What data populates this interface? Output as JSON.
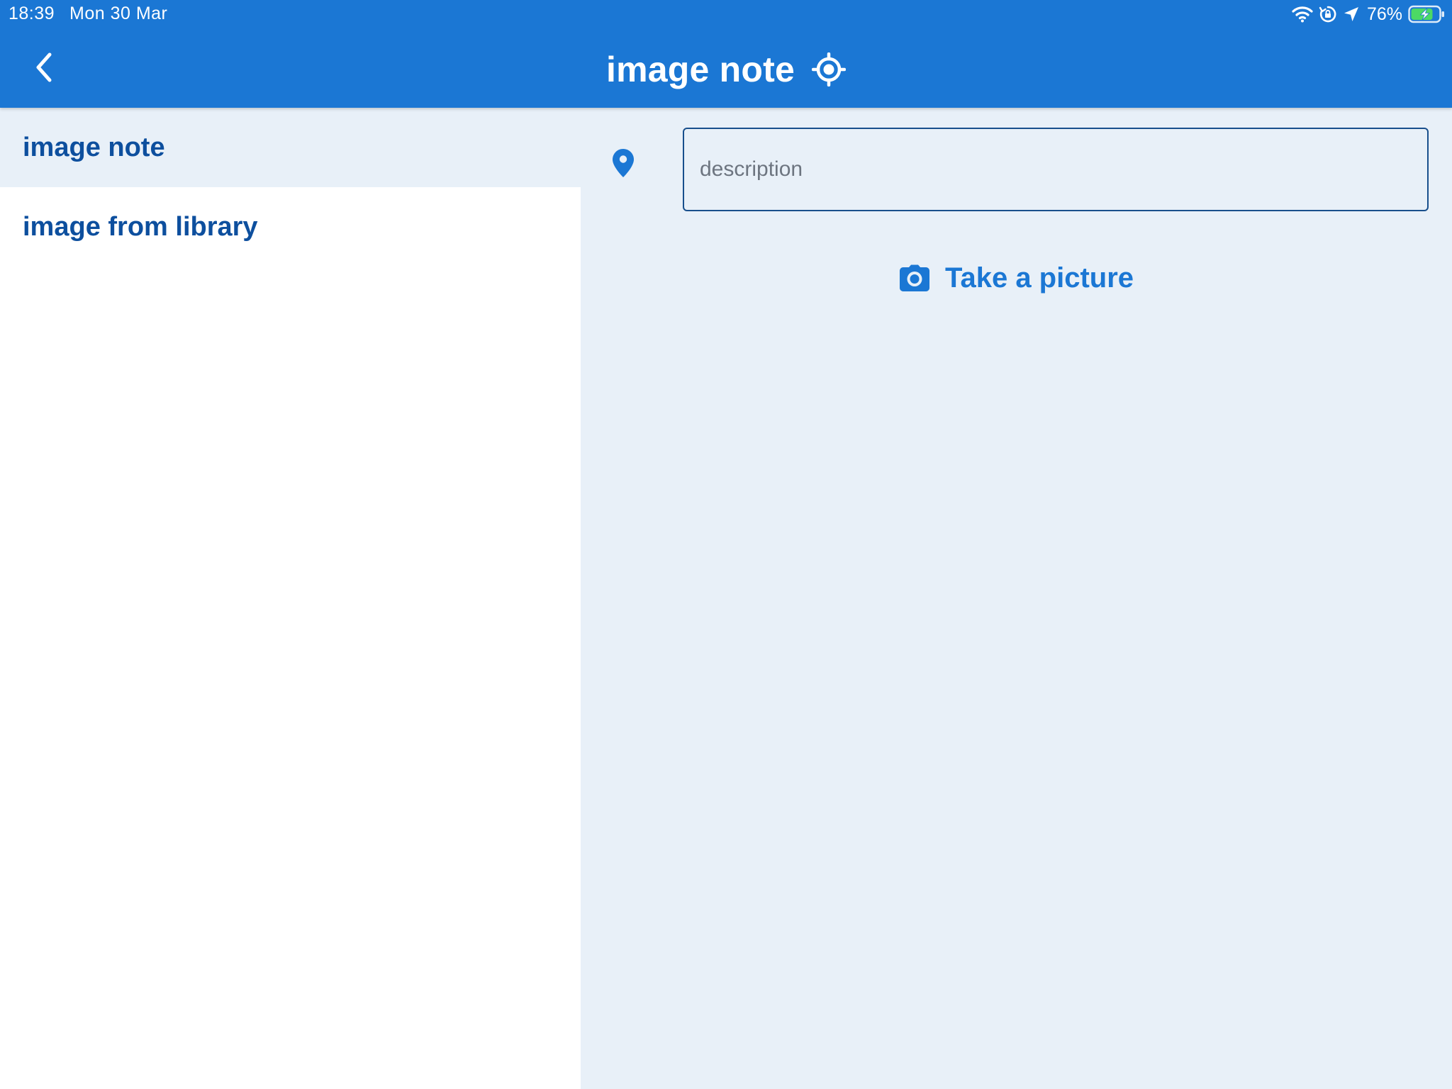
{
  "status_bar": {
    "time": "18:39",
    "date": "Mon 30 Mar",
    "battery_percent": "76%",
    "icons": [
      "wifi-icon",
      "rotation-lock-icon",
      "location-arrow-icon",
      "battery-charging-icon"
    ]
  },
  "nav_bar": {
    "title": "image note",
    "back_icon": "chevron-left-icon",
    "action_icon": "crosshair-locate-icon"
  },
  "sidebar": {
    "items": [
      {
        "label": "image note",
        "selected": true
      },
      {
        "label": "image from library",
        "selected": false
      }
    ]
  },
  "detail": {
    "location_icon": "map-pin-icon",
    "description": {
      "value": "",
      "placeholder": "description"
    },
    "take_picture": {
      "label": "Take a picture",
      "icon": "camera-icon"
    }
  },
  "colors": {
    "primary": "#1b77d4",
    "sidebar_text": "#0d4f9e",
    "pane_background": "#e8f0f8",
    "input_border": "#184f8c"
  }
}
